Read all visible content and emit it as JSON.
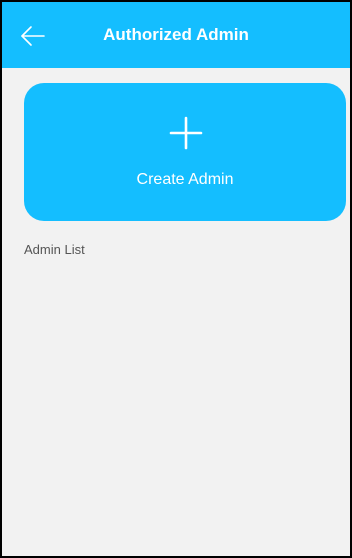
{
  "header": {
    "title": "Authorized Admin",
    "back_icon": "arrow-left-icon",
    "background_color": "#14beff"
  },
  "create_card": {
    "icon": "plus-icon",
    "label": "Create Admin",
    "background_color": "#14beff"
  },
  "admin_list": {
    "title": "Admin List",
    "items": []
  }
}
